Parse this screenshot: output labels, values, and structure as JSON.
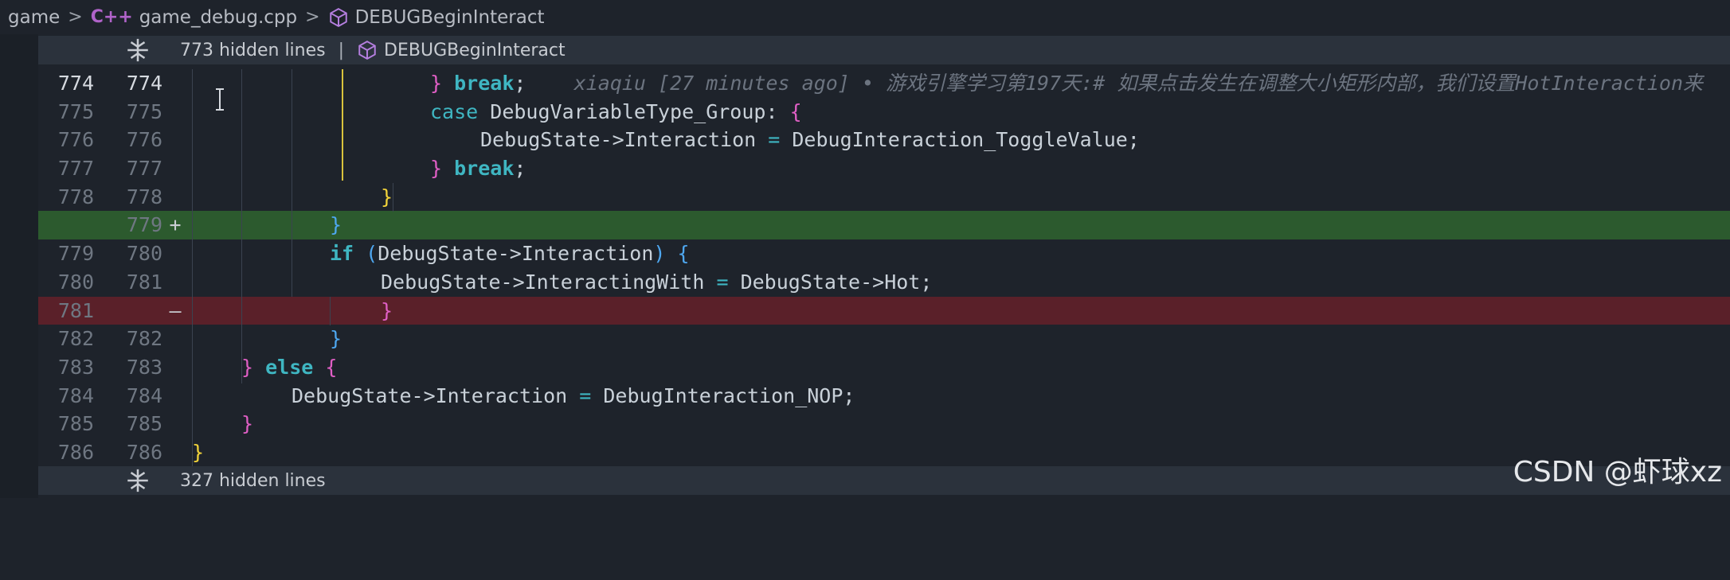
{
  "breadcrumb": {
    "folder": "game",
    "file_icon_text": "C++",
    "file": "game_debug.cpp",
    "symbol": "DEBUGBeginInteract"
  },
  "fold_top": {
    "hidden_text": "773 hidden lines",
    "separator": "|",
    "symbol": "DEBUGBeginInteract"
  },
  "fold_bottom": {
    "hidden_text": "327 hidden lines"
  },
  "lines": [
    {
      "old": "774",
      "new": "774",
      "marker": ""
    },
    {
      "old": "775",
      "new": "775",
      "marker": ""
    },
    {
      "old": "776",
      "new": "776",
      "marker": ""
    },
    {
      "old": "777",
      "new": "777",
      "marker": ""
    },
    {
      "old": "778",
      "new": "778",
      "marker": ""
    },
    {
      "old": "",
      "new": "779",
      "marker": "+"
    },
    {
      "old": "779",
      "new": "780",
      "marker": ""
    },
    {
      "old": "780",
      "new": "781",
      "marker": ""
    },
    {
      "old": "781",
      "new": "",
      "marker": "—"
    },
    {
      "old": "782",
      "new": "782",
      "marker": ""
    },
    {
      "old": "783",
      "new": "783",
      "marker": ""
    },
    {
      "old": "784",
      "new": "784",
      "marker": ""
    },
    {
      "old": "785",
      "new": "785",
      "marker": ""
    },
    {
      "old": "786",
      "new": "786",
      "marker": ""
    }
  ],
  "code": {
    "l774_brace": "}",
    "l774_break": "break",
    "l774_semi": ";",
    "l774_blame": "xiaqiu [27 minutes ago] • 游戏引擎学习第197天:# 如果点击发生在调整大小矩形内部，我们设置HotInteraction来",
    "l775_case": "case",
    "l775_label": " DebugVariableType_Group:",
    "l775_brace": "{",
    "l776_lhs": "DebugState->Interaction",
    "l776_eq": "=",
    "l776_rhs": "DebugInteraction_ToggleValue;",
    "l777_brace": "}",
    "l777_break": "break",
    "l777_semi": ";",
    "l778_brace": "}",
    "l779_brace": "}",
    "l780_if": "if",
    "l780_paren_open": "(",
    "l780_cond": "DebugState->Interaction",
    "l780_paren_close": ")",
    "l780_brace": "{",
    "l781_lhs": "DebugState->InteractingWith",
    "l781_eq": "=",
    "l781_rhs": "DebugState->Hot;",
    "l781r_brace": "}",
    "l782_brace": "}",
    "l783_brace": "}",
    "l783_else": "else",
    "l783_brace2": "{",
    "l784_lhs": "DebugState->Interaction",
    "l784_eq": "=",
    "l784_rhs": "DebugInteraction_NOP;",
    "l785_brace": "}",
    "l786_brace": "}"
  },
  "watermark": "CSDN @虾球xz",
  "colors": {
    "added_bg": "#2c5a2e",
    "removed_bg": "#5a2029",
    "keyword": "#3fb6c2",
    "bracket_pink": "#e05fc5",
    "bracket_yellow": "#f2d33a",
    "bracket_blue": "#4ea7f0"
  }
}
